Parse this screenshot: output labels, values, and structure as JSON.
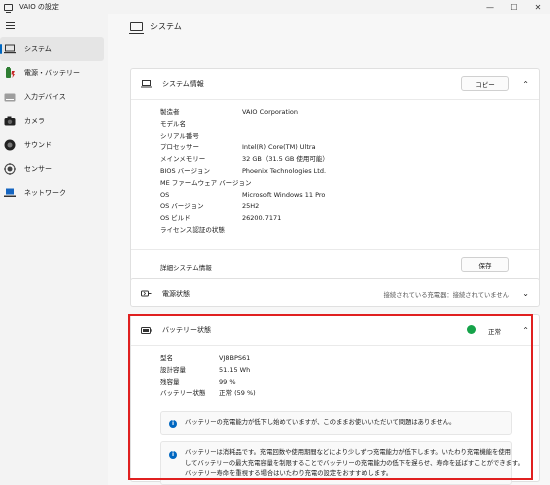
{
  "window": {
    "title": "VAIO の設定",
    "minimize": "—",
    "maximize": "☐",
    "close": "✕"
  },
  "sidebar": {
    "items": [
      {
        "label": "システム",
        "icon": "laptop-icon",
        "active": true
      },
      {
        "label": "電源・バッテリー",
        "icon": "battery-icon"
      },
      {
        "label": "入力デバイス",
        "icon": "keyboard-icon"
      },
      {
        "label": "カメラ",
        "icon": "camera-icon"
      },
      {
        "label": "サウンド",
        "icon": "speaker-icon"
      },
      {
        "label": "センサー",
        "icon": "sensor-icon"
      },
      {
        "label": "ネットワーク",
        "icon": "network-icon"
      }
    ]
  },
  "page": {
    "title": "システム"
  },
  "system_info": {
    "title": "システム情報",
    "copy_label": "コピー",
    "rows": [
      {
        "key": "製造者",
        "value": "VAIO Corporation"
      },
      {
        "key": "モデル名",
        "value": ""
      },
      {
        "key": "シリアル番号",
        "value": ""
      },
      {
        "key": "プロセッサー",
        "value": "Intel(R) Core(TM) Ultra"
      },
      {
        "key": "メインメモリー",
        "value": "32 GB（31.5 GB 使用可能）"
      },
      {
        "key": "BIOS バージョン",
        "value": "Phoenix Technologies Ltd."
      },
      {
        "key": "ME ファームウェア バージョン",
        "value": ""
      },
      {
        "key": "OS",
        "value": "Microsoft Windows 11 Pro"
      },
      {
        "key": "OS バージョン",
        "value": "25H2"
      },
      {
        "key": "OS ビルド",
        "value": "26200.7171"
      },
      {
        "key": "ライセンス認証の状態",
        "value": ""
      }
    ],
    "detail_label": "詳細システム情報",
    "save_label": "保存"
  },
  "power": {
    "title": "電源状態",
    "status": "接続されている充電器：接続されていません"
  },
  "battery": {
    "title": "バッテリー状態",
    "status": "正常",
    "status_color": "#16a34a",
    "rows": [
      {
        "key": "型名",
        "value": "VJ8BPS61"
      },
      {
        "key": "設計容量",
        "value": "51.15 Wh"
      },
      {
        "key": "残容量",
        "value": "99 %"
      },
      {
        "key": "バッテリー状態",
        "value": "正常 (59 %)"
      }
    ],
    "notice1": "バッテリーの充電能力が低下し始めていますが、このままお使いいただいて問題はありません。",
    "notice2_lines": [
      "バッテリーは消耗品です。充電回数や使用期間などにより少しずつ充電能力が低下します。いたわり充電機能を使用",
      "してバッテリーの最大充電容量を制限することでバッテリーの充電能力の低下を遅らせ、寿命を延ばすことができます。",
      "バッテリー寿命を重視する場合はいたわり充電の設定をおすすめします。"
    ]
  }
}
